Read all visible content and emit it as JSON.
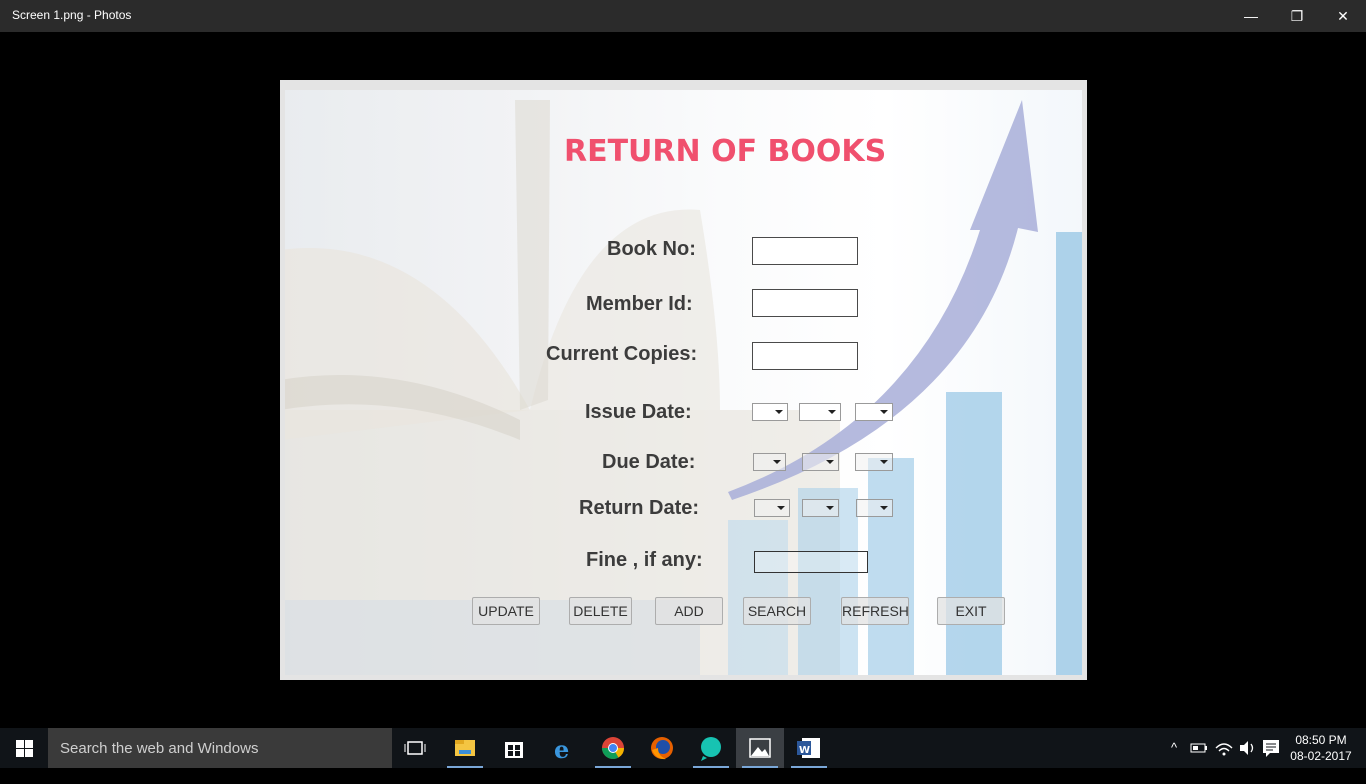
{
  "window": {
    "title": "Screen 1.png - Photos",
    "minimize_glyph": "—",
    "maximize_glyph": "❐",
    "close_glyph": "✕"
  },
  "form": {
    "heading": "RETURN OF BOOKS",
    "labels": {
      "book_no": "Book No:",
      "member_id": "Member Id:",
      "current_copies": "Current Copies:",
      "issue_date": "Issue Date:",
      "due_date": "Due Date:",
      "return_date": "Return Date:",
      "fine": "Fine , if any:"
    },
    "fields": {
      "book_no": "",
      "member_id": "",
      "current_copies": "",
      "fine": ""
    },
    "buttons": {
      "update": "UPDATE",
      "delete": "DELETE",
      "add": "ADD",
      "search": "SEARCH",
      "refresh": "REFRESH",
      "exit": "EXIT"
    },
    "colors": {
      "heading": "#f0506e",
      "label": "#3c3c3c"
    }
  },
  "taskbar": {
    "search_placeholder": "Search the web and Windows",
    "apps": [
      "task-view-icon",
      "file-explorer-icon",
      "store-icon",
      "edge-icon",
      "chrome-icon",
      "firefox-icon",
      "app-icon",
      "photos-icon",
      "word-icon"
    ],
    "tray_chevron": "^",
    "time": "08:50 PM",
    "date": "08-02-2017"
  }
}
